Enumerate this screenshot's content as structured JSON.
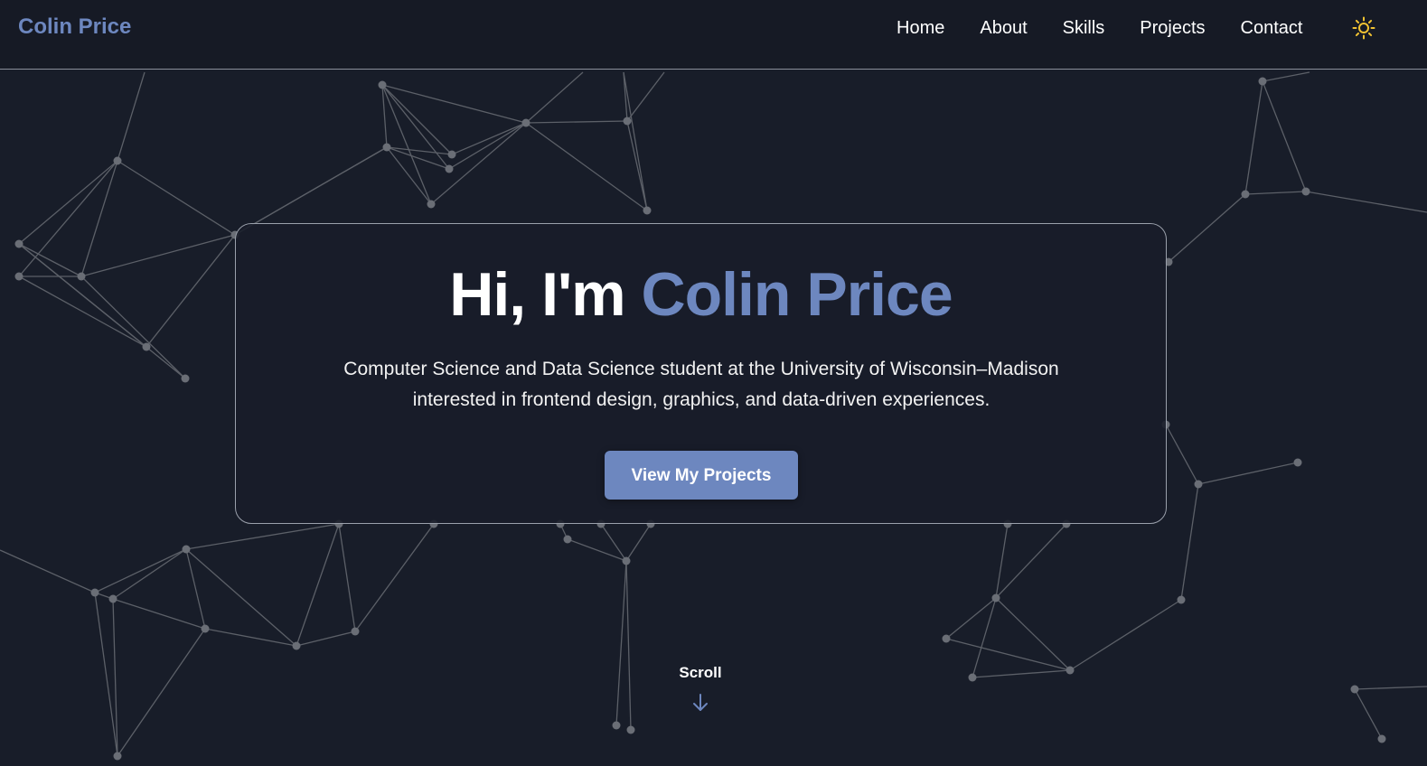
{
  "nav": {
    "brand": "Colin Price",
    "links": [
      {
        "label": "Home"
      },
      {
        "label": "About"
      },
      {
        "label": "Skills"
      },
      {
        "label": "Projects"
      },
      {
        "label": "Contact"
      }
    ],
    "theme_toggle_icon": "sun-icon"
  },
  "hero": {
    "title_prefix": "Hi, I'm ",
    "title_name": "Colin Price",
    "subtitle": "Computer Science and Data Science student at the University of Wisconsin–Madison interested in frontend design, graphics, and data-driven experiences.",
    "cta_label": "View My Projects"
  },
  "scroll": {
    "label": "Scroll",
    "icon": "arrow-down-icon"
  },
  "colors": {
    "background": "#181d29",
    "accent": "#6d87bf",
    "sun": "#f1c232",
    "network": "#5c6068"
  }
}
